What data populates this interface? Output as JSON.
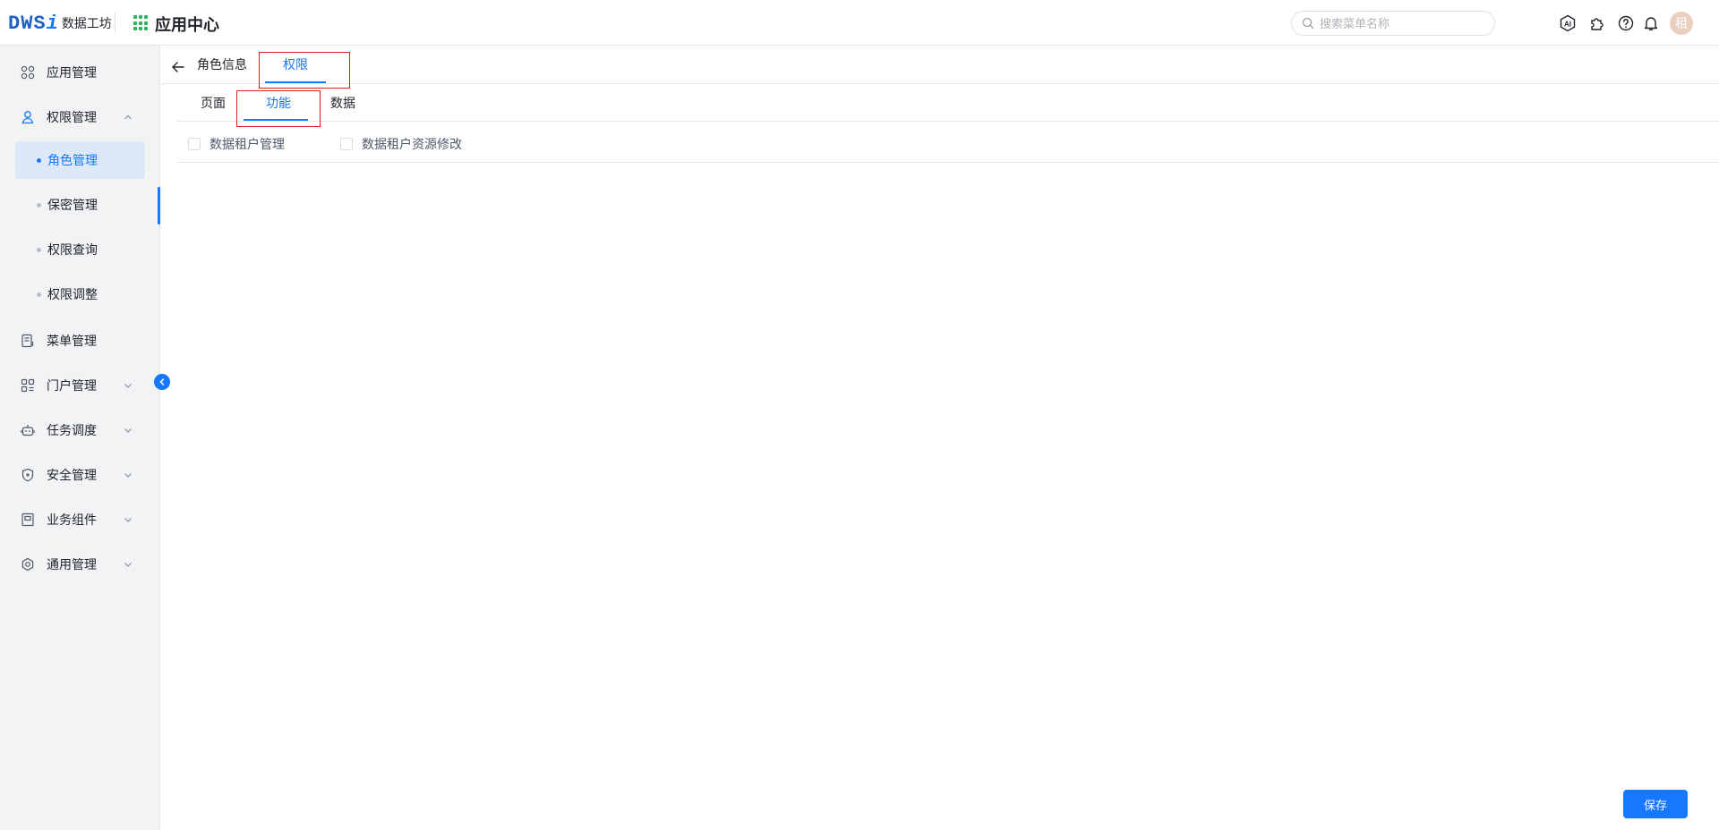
{
  "header": {
    "logo_mark": "DWS",
    "logo_mark_i": "i",
    "logo_text": "数据工坊",
    "app_center": "应用中心",
    "search_placeholder": "搜索菜单名称",
    "icons": [
      "ai-icon",
      "plugin-icon",
      "help-icon",
      "bell-icon"
    ],
    "avatar_text": "租"
  },
  "sidebar": {
    "items": [
      {
        "label": "应用管理",
        "icon": "grid-icon"
      },
      {
        "label": "权限管理",
        "icon": "user-icon",
        "expanded": true
      },
      {
        "label": "菜单管理",
        "icon": "menu-doc-icon"
      },
      {
        "label": "门户管理",
        "icon": "portal-icon"
      },
      {
        "label": "任务调度",
        "icon": "robot-icon"
      },
      {
        "label": "安全管理",
        "icon": "shield-icon"
      },
      {
        "label": "业务组件",
        "icon": "component-icon"
      },
      {
        "label": "通用管理",
        "icon": "settings-icon"
      }
    ],
    "sub_items": [
      {
        "label": "角色管理",
        "active": true
      },
      {
        "label": "保密管理"
      },
      {
        "label": "权限查询"
      },
      {
        "label": "权限调整"
      }
    ]
  },
  "main": {
    "top_tabs": [
      {
        "label": "角色信息"
      },
      {
        "label": "权限",
        "active": true
      }
    ],
    "sub_tabs": [
      {
        "label": "页面"
      },
      {
        "label": "功能",
        "active": true
      },
      {
        "label": "数据"
      }
    ],
    "permissions": [
      {
        "label": "数据租户管理",
        "checked": false
      },
      {
        "label": "数据租户资源修改",
        "checked": false
      }
    ],
    "save_label": "保存"
  },
  "colors": {
    "accent": "#1677ff",
    "highlight_box": "#e02020",
    "sidebar_bg": "#f2f3f5"
  }
}
